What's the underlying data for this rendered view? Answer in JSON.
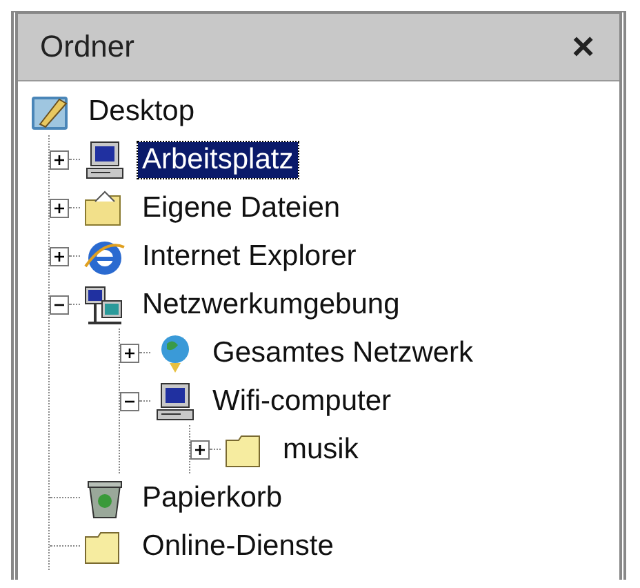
{
  "panel": {
    "title": "Ordner",
    "close": "×"
  },
  "tree": [
    {
      "label": "Desktop",
      "kind": "desktop",
      "selected": false,
      "children": [
        {
          "label": "Arbeitsplatz",
          "kind": "computer",
          "expanded": false,
          "selected": true
        },
        {
          "label": "Eigene Dateien",
          "kind": "open-folder",
          "expanded": false,
          "selected": false
        },
        {
          "label": "Internet Explorer",
          "kind": "browser",
          "expanded": false,
          "selected": false
        },
        {
          "label": "Netzwerkumgebung",
          "kind": "network",
          "expanded": true,
          "selected": false,
          "children": [
            {
              "label": "Gesamtes Netzwerk",
              "kind": "globe",
              "expanded": false,
              "selected": false
            },
            {
              "label": "Wifi-computer",
              "kind": "computer",
              "expanded": true,
              "selected": false,
              "children": [
                {
                  "label": "musik",
                  "kind": "folder",
                  "expanded": false,
                  "selected": false
                }
              ]
            }
          ]
        },
        {
          "label": "Papierkorb",
          "kind": "recycle-bin",
          "selected": false
        },
        {
          "label": "Online-Dienste",
          "kind": "folder",
          "selected": false
        }
      ]
    }
  ]
}
